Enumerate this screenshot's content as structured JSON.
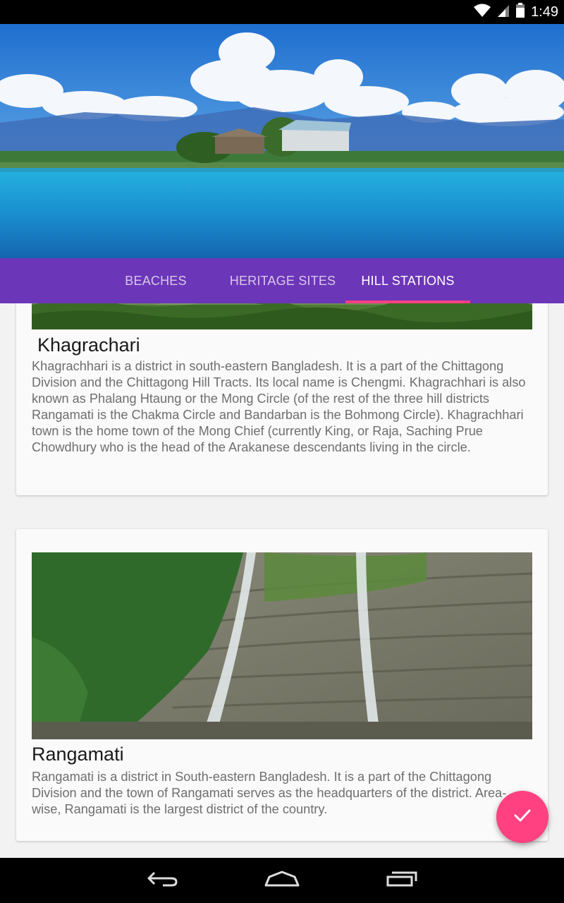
{
  "status_bar": {
    "time": "1:49",
    "icons": [
      "wifi-icon",
      "signal-icon",
      "battery-icon"
    ]
  },
  "header": {
    "image": "lake-with-huts-and-blue-sky"
  },
  "tabs": [
    {
      "label": "BEACHES",
      "active": false
    },
    {
      "label": "HERITAGE SITES",
      "active": false
    },
    {
      "label": "HILL STATIONS",
      "active": true
    }
  ],
  "cards": [
    {
      "title": "Khagrachari",
      "description": "Khagrachhari is a district in south-eastern Bangladesh. It is a part of the Chittagong Division and the Chittagong Hill Tracts. Its local name is Chengmi. Khagrachhari is also known as Phalang Htaung or the Mong Circle (of the rest of the three hill districts Rangamati is the Chakma Circle and Bandarban is the Bohmong Circle). Khagrachhari town is the home town of the Mong Chief (currently King, or Raja, Saching Prue Chowdhury who is the head of the Arakanese descendants living in the circle.",
      "image": "green-hills-landscape"
    },
    {
      "title": "Rangamati",
      "description": "Rangamati is a district in South-eastern Bangladesh. It is a part of the Chittagong Division and the town of Rangamati serves as the headquarters of the district. Area-wise, Rangamati is the largest district of the country.",
      "image": "waterfall-over-rock-cliff"
    }
  ],
  "fab": {
    "icon": "check-icon"
  },
  "nav_bar": {
    "icons": [
      "back-icon",
      "home-icon",
      "recents-icon"
    ]
  },
  "colors": {
    "primary": "#6c36b8",
    "accent": "#ff4081",
    "card_background": "#fafafa",
    "page_background": "#f2f2f2"
  }
}
